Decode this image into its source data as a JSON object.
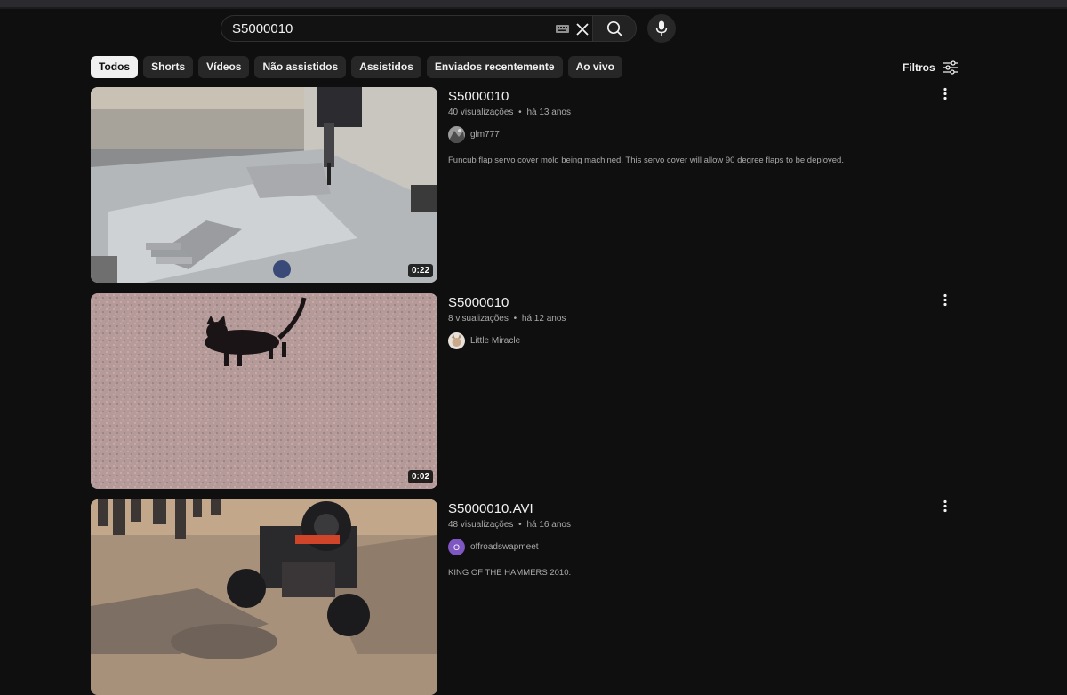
{
  "search": {
    "query": "S5000010"
  },
  "chips": [
    {
      "label": "Todos",
      "active": true
    },
    {
      "label": "Shorts"
    },
    {
      "label": "Vídeos"
    },
    {
      "label": "Não assistidos"
    },
    {
      "label": "Assistidos"
    },
    {
      "label": "Enviados recentemente"
    },
    {
      "label": "Ao vivo"
    }
  ],
  "filters": {
    "label": "Filtros"
  },
  "results": [
    {
      "title": "S5000010",
      "views": "40 visualizações",
      "age": "há 13 anos",
      "channel": "glm777",
      "description": "Funcub flap servo cover mold being machined. This servo cover will allow 90 degree flaps to be deployed.",
      "duration": "0:22"
    },
    {
      "title": "S5000010",
      "views": "8 visualizações",
      "age": "há 12 anos",
      "channel": "Little Miracle",
      "description": "",
      "duration": "0:02"
    },
    {
      "title": "S5000010.AVI",
      "views": "48 visualizações",
      "age": "há 16 anos",
      "channel": "offroadswapmeet",
      "channel_initial": "O",
      "description": "KING OF THE HAMMERS 2010.",
      "duration": ""
    }
  ],
  "separator": "•",
  "colors": {
    "background": "#0f0f0f",
    "chip": "#272727",
    "chip_active": "#f1f1f1",
    "text_primary": "#f1f1f1",
    "text_secondary": "#aaaaaa",
    "avatar_purple": "#7e57c2"
  },
  "icons": [
    "keyboard-icon",
    "clear-icon",
    "search-icon",
    "mic-icon",
    "filter-sliders-icon",
    "more-vert-icon"
  ]
}
